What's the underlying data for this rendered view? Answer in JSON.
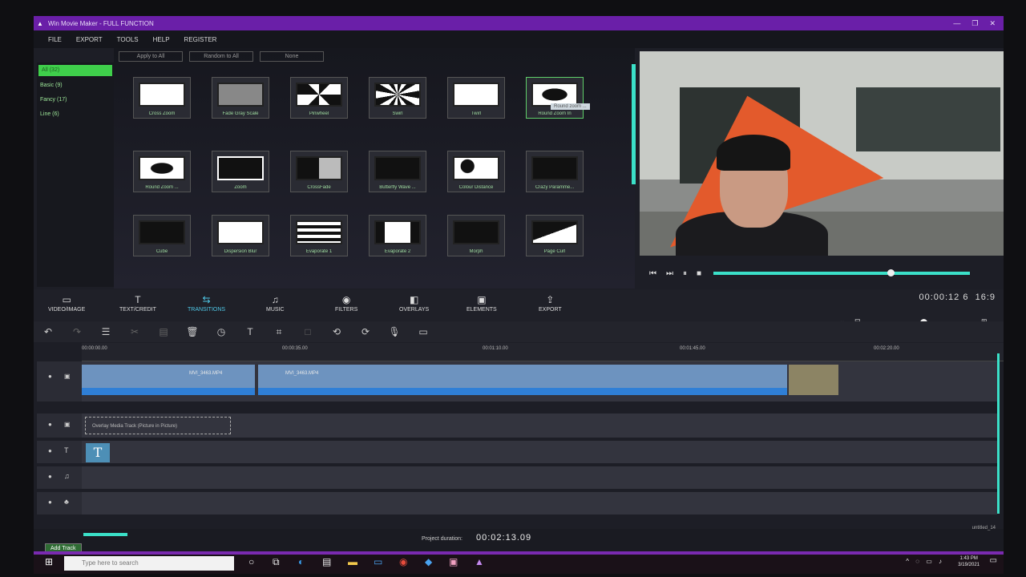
{
  "window": {
    "title": "Win Movie Maker - FULL FUNCTION",
    "controls": [
      "—",
      "❐",
      "✕"
    ]
  },
  "menu": [
    "FILE",
    "EXPORT",
    "TOOLS",
    "HELP",
    "REGISTER"
  ],
  "sidebar": [
    "All (32)",
    "Basic (9)",
    "Fancy (17)",
    "Line (6)"
  ],
  "apply_buttons": [
    "Apply to All",
    "Random to All",
    "None"
  ],
  "transitions": [
    "Cross Zoom",
    "Fade Gray Scale",
    "Pinwheel",
    "Swirl",
    "Twirl",
    "Round Zoom In",
    "Round Zoom ...",
    "Zoom",
    "CrossFade",
    "Butterfly Wave ...",
    "Colour Distance",
    "Crazy Paramme...",
    "Cube",
    "Dispersion Blur",
    "Evaporate 1",
    "Evaporate 2",
    "Morph",
    "Page Curl"
  ],
  "tooltip": "Round zoom ...",
  "main_tabs": [
    "VIDEO/IMAGE",
    "TEXT/CREDIT",
    "TRANSITIONS",
    "MUSIC",
    "FILTERS",
    "OVERLAYS",
    "ELEMENTS",
    "EXPORT"
  ],
  "timecode": "00:00:12 6",
  "aspect": "16:9",
  "ruler": [
    "00:00:00.00",
    "00:00:35.00",
    "00:01:10.00",
    "00:01:45.00",
    "00:02:20.00"
  ],
  "clips": [
    "MVI_3463.MP4",
    "MVI_3463.MP4"
  ],
  "overlay_track": "Overlay Media Track (Picture in Picture)",
  "text_track_icon": "T",
  "add_track": "Add Track",
  "project_duration_label": "Project duration:",
  "project_duration": "00:02:13.09",
  "project_name": "untitled_14",
  "taskbar": {
    "search_placeholder": "Type here to search",
    "time": "1:43 PM",
    "date": "3/19/2021"
  },
  "playback": {
    "position_fraction": 0.69
  }
}
